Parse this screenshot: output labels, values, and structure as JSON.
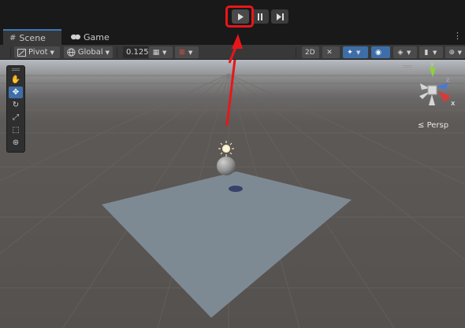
{
  "play_toolbar": {
    "play_icon": "play-icon",
    "pause_icon": "pause-icon",
    "step_icon": "step-icon",
    "highlight_color": "#e8161a"
  },
  "tabs": [
    {
      "label": "Scene",
      "icon": "grid-icon"
    },
    {
      "label": "Game",
      "icon": "gamepad-icon"
    }
  ],
  "tab_menu": "⋮",
  "scene_toolbar": {
    "pivot_label": "Pivot",
    "global_label": "Global",
    "snap_value": "0.125"
  },
  "scene_view": {
    "camera_mode": "Persp",
    "gizmo_axes": {
      "y": "y",
      "x": "x",
      "z": "z"
    }
  },
  "colors": {
    "accent_blue": "#3e6ea8",
    "annotation_red": "#e8161a",
    "plane": "#7e8a93"
  }
}
